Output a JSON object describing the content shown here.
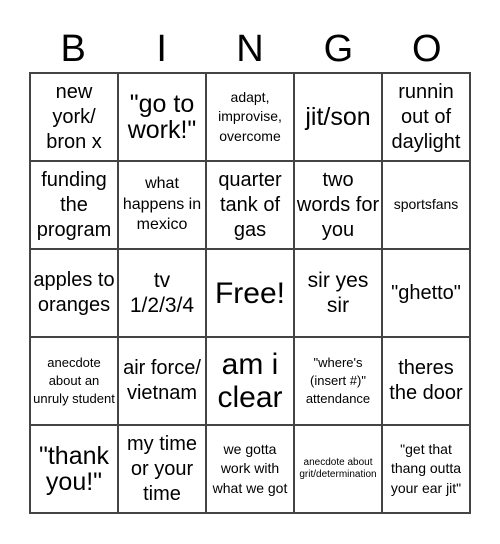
{
  "header": [
    "B",
    "I",
    "N",
    "G",
    "O"
  ],
  "cells": [
    [
      "new york/ bron x",
      "\"go to work!\"",
      "adapt, improvise, overcome",
      "jit/son",
      "runnin out of daylight"
    ],
    [
      "funding the program",
      "what happens in mexico",
      "quarter tank of gas",
      "two words for you",
      "sportsfans"
    ],
    [
      "apples to oranges",
      "tv 1/2/3/4",
      "Free!",
      "sir yes sir",
      "\"ghetto\""
    ],
    [
      "anecdote about an unruly student",
      "air force/ vietnam",
      "am i clear",
      "\"where's (insert #)\" attendance",
      "theres the door"
    ],
    [
      "\"thank you!\"",
      "my time or your time",
      "we gotta work with what we got",
      "anecdote about grit/determination",
      "\"get that thang outta your ear jit\""
    ]
  ]
}
